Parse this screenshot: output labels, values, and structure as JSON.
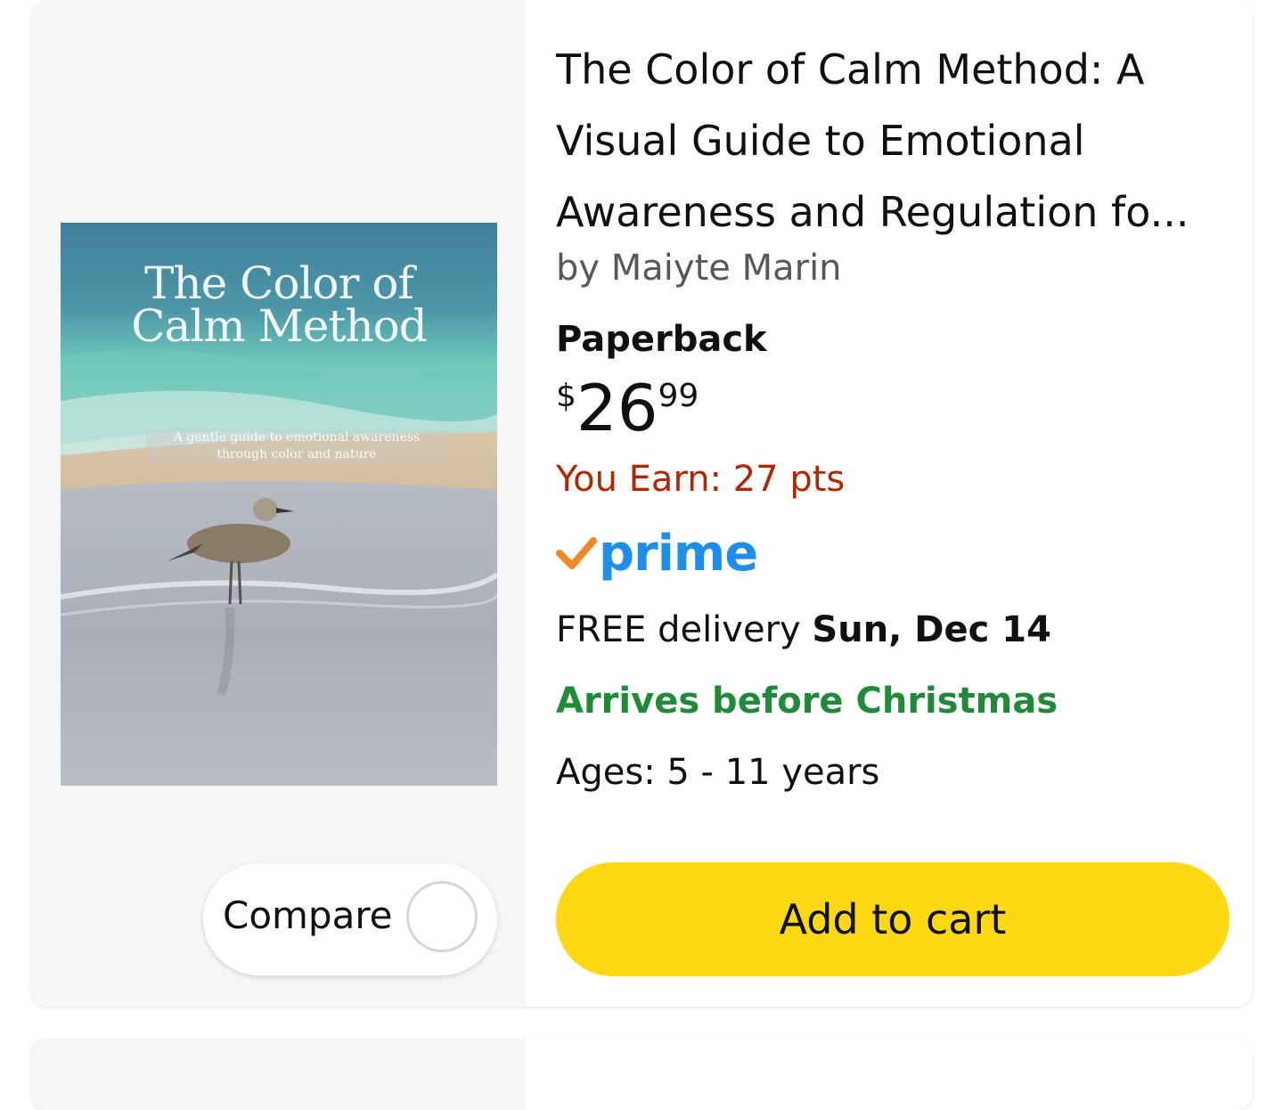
{
  "product": {
    "title": "The Color of Calm Method: A Visual Guide to Emotional Awareness and Regulation fo...",
    "author": "by Maiyte Marin",
    "format": "Paperback",
    "price": {
      "symbol": "$",
      "whole": "26",
      "fraction": "99"
    },
    "earn": "You Earn: 27 pts",
    "prime_label": "prime",
    "delivery": {
      "prefix": "FREE delivery ",
      "date": "Sun, Dec 14"
    },
    "arrives": "Arrives before Christmas",
    "ages": "Ages: 5 - 11 years"
  },
  "cover": {
    "title_line1": "The Color of",
    "title_line2": "Calm Method",
    "subtitle_line1": "A gentle guide to emotional awareness",
    "subtitle_line2": "through color and nature"
  },
  "actions": {
    "compare_label": "Compare",
    "add_to_cart_label": "Add to cart"
  },
  "colors": {
    "price_red": "#b12704",
    "green": "#1f8a38",
    "prime_blue": "#1f8ee8",
    "prime_check": "#f08a24",
    "cart_yellow": "#ffd814"
  },
  "icons": [
    "prime-check-icon",
    "compare-radio-icon"
  ]
}
